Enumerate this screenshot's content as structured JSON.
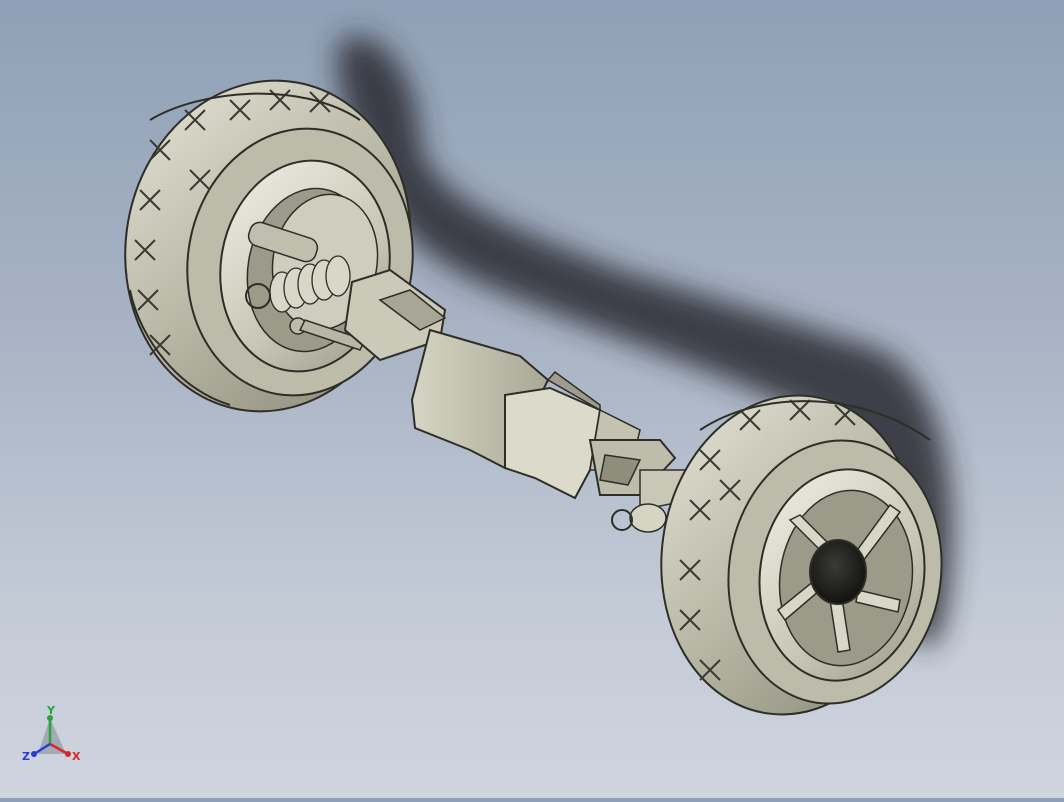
{
  "viewport": {
    "background_top": "#8fa0b6",
    "background_bottom": "#cfd5de"
  },
  "model": {
    "part_color": "#c9c8b6",
    "shadow_color": "#2a2c30"
  },
  "triad": {
    "x_label": "X",
    "y_label": "Y",
    "z_label": "Z",
    "x_color": "#d8262a",
    "y_color": "#2aa33a",
    "z_color": "#2a3cd8"
  }
}
